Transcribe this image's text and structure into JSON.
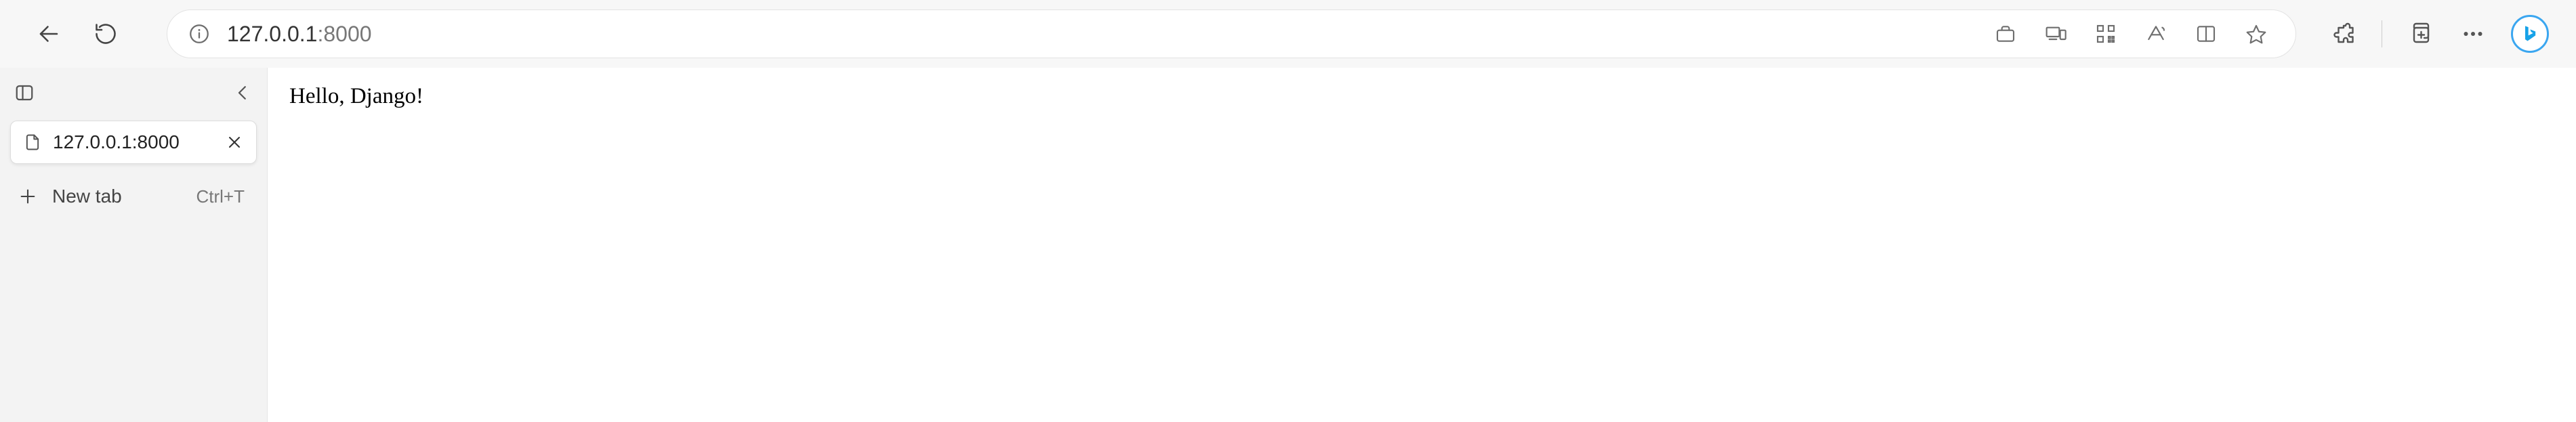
{
  "address_bar": {
    "url_host": "127.0.0.1",
    "url_port": ":8000"
  },
  "sidebar": {
    "tabs": [
      {
        "title": "127.0.0.1:8000"
      }
    ],
    "new_tab": {
      "label": "New tab",
      "shortcut": "Ctrl+T"
    }
  },
  "page": {
    "body_text": "Hello, Django!"
  }
}
